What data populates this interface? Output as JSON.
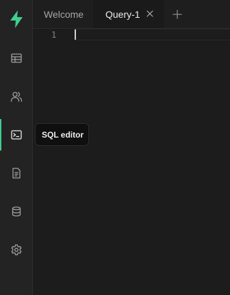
{
  "sidebar": {
    "items": [
      {
        "id": "table-editor",
        "icon": "table-icon"
      },
      {
        "id": "authentication",
        "icon": "users-icon"
      },
      {
        "id": "sql-editor",
        "icon": "terminal-icon",
        "active": true
      },
      {
        "id": "docs",
        "icon": "document-icon"
      },
      {
        "id": "database",
        "icon": "database-icon"
      },
      {
        "id": "settings",
        "icon": "gear-icon"
      }
    ]
  },
  "tabs": [
    {
      "label": "Welcome",
      "active": false
    },
    {
      "label": "Query-1",
      "active": true,
      "closable": true
    }
  ],
  "editor": {
    "line_numbers": [
      "1"
    ]
  },
  "tooltip": {
    "label": "SQL editor"
  },
  "colors": {
    "accent": "#3ecf8e",
    "background": "#1c1c1c",
    "sidebar": "#232323"
  }
}
